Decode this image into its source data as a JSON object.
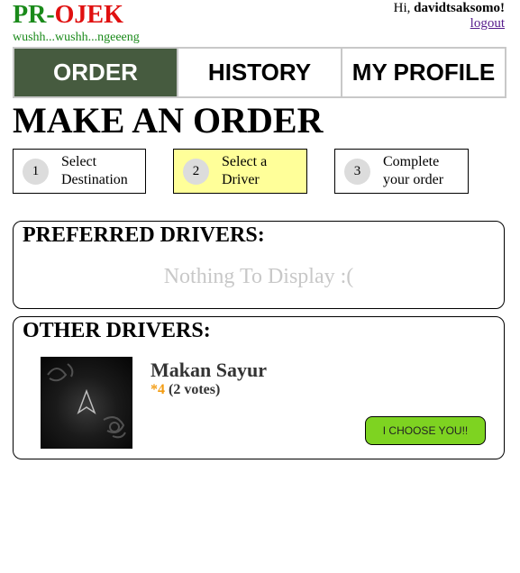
{
  "header": {
    "logo_part1": "PR",
    "logo_dash": "-",
    "logo_part2": "OJEK",
    "tagline": "wushh...wushh...ngeeeng",
    "greeting_prefix": "Hi, ",
    "username": "davidtsaksomo!",
    "logout_label": "logout"
  },
  "nav": {
    "tabs": [
      {
        "label": "ORDER",
        "active": true
      },
      {
        "label": "HISTORY",
        "active": false
      },
      {
        "label": "MY PROFILE",
        "active": false
      }
    ]
  },
  "page_title": "MAKE AN ORDER",
  "steps": [
    {
      "number": "1",
      "line1": "Select",
      "line2": "Destination",
      "active": false
    },
    {
      "number": "2",
      "line1": "Select a",
      "line2": "Driver",
      "active": true
    },
    {
      "number": "3",
      "line1": "Complete",
      "line2": "your order",
      "active": false
    }
  ],
  "preferred": {
    "title": "PREFERRED DRIVERS:",
    "empty_message": "Nothing To Display :("
  },
  "other": {
    "title": "OTHER DRIVERS:",
    "drivers": [
      {
        "name": "Makan Sayur",
        "rating_star": "*4",
        "votes": "(2 votes)",
        "button_label": "I CHOOSE YOU!!"
      }
    ]
  },
  "colors": {
    "active_tab": "#465b3f",
    "active_step": "#ffff99",
    "choose_button": "#7ed321",
    "logo_green": "#1a8a1a",
    "logo_red": "#e01010",
    "star": "#f39c12"
  }
}
